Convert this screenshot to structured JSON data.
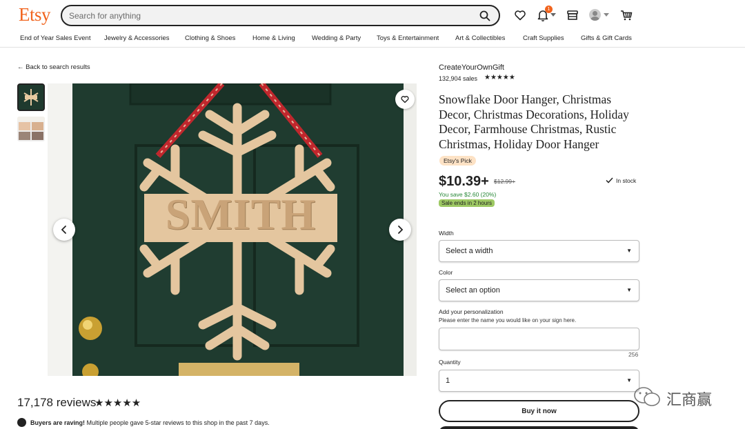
{
  "header": {
    "logo": "Etsy",
    "search_placeholder": "Search for anything",
    "notification_count": "1",
    "icons": [
      "search-icon",
      "heart-icon",
      "bell-icon",
      "shop-icon",
      "avatar-icon",
      "cart-icon"
    ]
  },
  "nav": {
    "items": [
      "End of Year Sales Event",
      "Jewelry & Accessories",
      "Clothing & Shoes",
      "Home & Living",
      "Wedding & Party",
      "Toys & Entertainment",
      "Art & Collectibles",
      "Craft Supplies",
      "Gifts & Gift Cards"
    ]
  },
  "gallery": {
    "back_link": "Back to search results",
    "sign_text": "SMITH"
  },
  "reviews": {
    "count_text": "17,178 reviews",
    "stars": "★★★★★",
    "raving_bold": "Buyers are raving!",
    "raving_text": " Multiple people gave 5-star reviews to this shop in the past 7 days."
  },
  "product": {
    "shop_name": "CreateYourOwnGift",
    "sales": "132,904 sales",
    "shop_stars": "★★★★★",
    "title": "Snowflake Door Hanger, Christmas Decor, Christmas Decorations, Holiday Decor, Farmhouse Christmas, Rustic Christmas, Holiday Door Hanger",
    "pick_badge": "Etsy's Pick",
    "price": "$10.39+",
    "old_price": "$12.99+",
    "stock": "In stock",
    "savings": "You save $2.60 (20%)",
    "sale_ends": "Sale ends in 2 hours"
  },
  "options": {
    "width_label": "Width",
    "width_value": "Select a width",
    "color_label": "Color",
    "color_value": "Select an option",
    "personalization_label": "Add your personalization",
    "personalization_desc": "Please enter the name you would like on your sign here.",
    "char_count": "256",
    "quantity_label": "Quantity",
    "quantity_value": "1",
    "buy_label": "Buy it now"
  },
  "watermark": {
    "text": "汇商赢"
  },
  "colors": {
    "brand": "#f1641e",
    "sale_green": "#9ec964",
    "pick_bg": "#fde2c5",
    "door_green": "#203c30"
  }
}
